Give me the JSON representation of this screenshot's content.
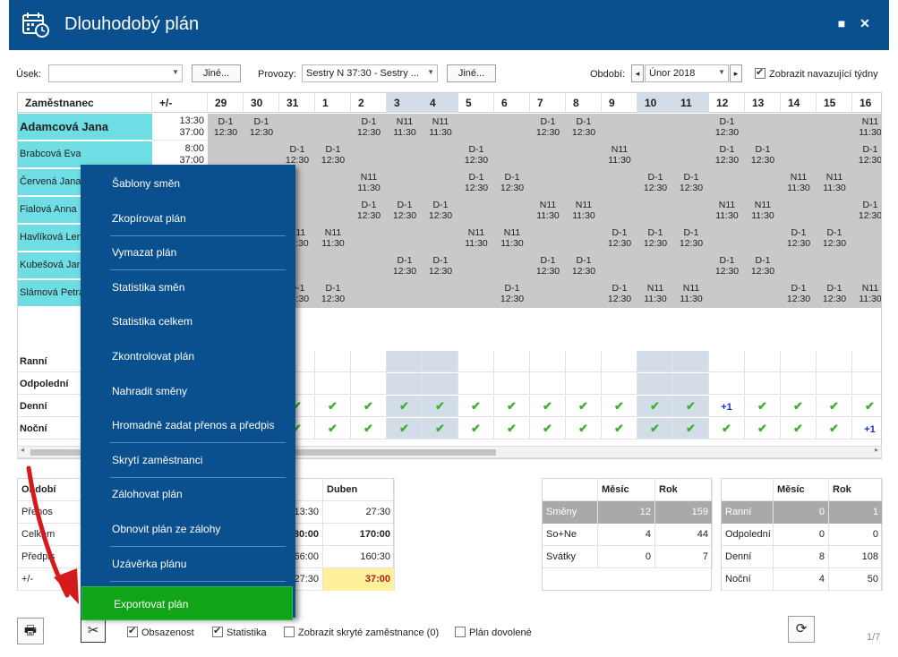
{
  "window": {
    "title": "Dlouhodobý plán",
    "minimize_symbol": "■",
    "close_symbol": "✕"
  },
  "toolbar": {
    "usek_label": "Úsek:",
    "usek_value": "",
    "jine1": "Jiné...",
    "provozy_label": "Provozy:",
    "provozy_value": "Sestry N 37:30 - Sestry ...",
    "jine2": "Jiné...",
    "obdobi_label": "Období:",
    "obdobi_value": "Únor 2018",
    "prev": "◂",
    "next": "▸",
    "show_weeks_label": "Zobrazit navazující týdny"
  },
  "grid": {
    "col_employee": "Zaměstnanec",
    "col_pm": "+/-",
    "days": [
      "29",
      "30",
      "31",
      "1",
      "2",
      "3",
      "4",
      "5",
      "6",
      "7",
      "8",
      "9",
      "10",
      "11",
      "12",
      "13",
      "14",
      "15",
      "16"
    ],
    "weekend": [
      5,
      6,
      12,
      13
    ],
    "employees": [
      {
        "name": "Adamcová Jana",
        "pm1": "13:30",
        "pm2": "37:00",
        "big": true,
        "shifts": [
          [
            "D-1",
            "12:30"
          ],
          [
            "D-1",
            "12:30"
          ],
          null,
          null,
          [
            "D-1",
            "12:30"
          ],
          [
            "N11",
            "11:30"
          ],
          [
            "N11",
            "11:30"
          ],
          null,
          null,
          [
            "D-1",
            "12:30"
          ],
          [
            "D-1",
            "12:30"
          ],
          null,
          null,
          null,
          [
            "D-1",
            "12:30"
          ],
          null,
          null,
          null,
          [
            "N11",
            "11:30"
          ]
        ]
      },
      {
        "name": "Brabcová Eva",
        "pm1": "8:00",
        "pm2": "37:00",
        "shifts": [
          null,
          null,
          [
            "D-1",
            "12:30"
          ],
          [
            "D-1",
            "12:30"
          ],
          null,
          null,
          null,
          [
            "D-1",
            "12:30"
          ],
          null,
          null,
          null,
          [
            "N11",
            "11:30"
          ],
          null,
          null,
          [
            "D-1",
            "12:30"
          ],
          [
            "D-1",
            "12:30"
          ],
          null,
          null,
          [
            "D-1",
            "12:30"
          ]
        ]
      },
      {
        "name": "Červená Jana",
        "shifts": [
          null,
          null,
          null,
          null,
          [
            "N11",
            "11:30"
          ],
          null,
          null,
          [
            "D-1",
            "12:30"
          ],
          [
            "D-1",
            "12:30"
          ],
          null,
          null,
          null,
          [
            "D-1",
            "12:30"
          ],
          [
            "D-1",
            "12:30"
          ],
          null,
          null,
          [
            "N11",
            "11:30"
          ],
          [
            "N11",
            "11:30"
          ],
          null
        ]
      },
      {
        "name": "Fialová Anna",
        "shifts": [
          null,
          null,
          null,
          null,
          [
            "D-1",
            "12:30"
          ],
          [
            "D-1",
            "12:30"
          ],
          [
            "D-1",
            "12:30"
          ],
          null,
          null,
          [
            "N11",
            "11:30"
          ],
          [
            "N11",
            "11:30"
          ],
          null,
          null,
          null,
          [
            "N11",
            "11:30"
          ],
          [
            "N11",
            "11:30"
          ],
          null,
          null,
          [
            "D-1",
            "12:30"
          ]
        ]
      },
      {
        "name": "Havlíková Lenka",
        "shifts": [
          null,
          null,
          [
            "N11",
            "11:30"
          ],
          [
            "N11",
            "11:30"
          ],
          null,
          null,
          null,
          [
            "N11",
            "11:30"
          ],
          [
            "N11",
            "11:30"
          ],
          null,
          null,
          [
            "D-1",
            "12:30"
          ],
          [
            "D-1",
            "12:30"
          ],
          [
            "D-1",
            "12:30"
          ],
          null,
          null,
          [
            "D-1",
            "12:30"
          ],
          [
            "D-1",
            "12:30"
          ],
          null
        ]
      },
      {
        "name": "Kubešová Jarosl.",
        "shifts": [
          null,
          null,
          null,
          null,
          null,
          [
            "D-1",
            "12:30"
          ],
          [
            "D-1",
            "12:30"
          ],
          null,
          null,
          [
            "D-1",
            "12:30"
          ],
          [
            "D-1",
            "12:30"
          ],
          null,
          null,
          null,
          [
            "D-1",
            "12:30"
          ],
          [
            "D-1",
            "12:30"
          ],
          null,
          null,
          null
        ]
      },
      {
        "name": "Slámová Petra",
        "shifts": [
          null,
          null,
          [
            "D-1",
            "12:30"
          ],
          [
            "D-1",
            "12:30"
          ],
          null,
          null,
          null,
          null,
          [
            "D-1",
            "12:30"
          ],
          null,
          null,
          [
            "D-1",
            "12:30"
          ],
          [
            "N11",
            "11:30"
          ],
          [
            "N11",
            "11:30"
          ],
          null,
          null,
          [
            "D-1",
            "12:30"
          ],
          [
            "D-1",
            "12:30"
          ],
          [
            "N11",
            "11:30"
          ]
        ]
      }
    ],
    "summary_rows": [
      "Ranní",
      "Odpolední",
      "Denní",
      "Noční"
    ],
    "denni_marks": [
      "✔",
      "✔",
      "✔",
      "✔",
      "✔",
      "✔",
      "✔",
      "✔",
      "✔",
      "✔",
      "✔",
      "✔",
      "✔",
      "✔",
      "+1",
      "✔",
      "✔",
      "✔",
      "✔"
    ],
    "nocni_marks": [
      "✔",
      "✔",
      "✔",
      "✔",
      "✔",
      "✔",
      "✔",
      "✔",
      "✔",
      "✔",
      "✔",
      "✔",
      "✔",
      "✔",
      "✔",
      "✔",
      "✔",
      "✔",
      "+1"
    ]
  },
  "bottom_left": {
    "headers": [
      "Období",
      "",
      "Duben"
    ],
    "rows": [
      [
        "Přenos",
        "13:30",
        "27:30"
      ],
      [
        "Celkem",
        "80:00",
        "170:00"
      ],
      [
        "Předpis",
        "66:00",
        "160:30"
      ],
      [
        "+/-",
        "27:30",
        "37:00"
      ]
    ]
  },
  "bottom_mid": {
    "headers": [
      "",
      "Měsíc",
      "Rok"
    ],
    "rows": [
      [
        "Směny",
        "12",
        "159"
      ],
      [
        "So+Ne",
        "4",
        "44"
      ],
      [
        "Svátky",
        "0",
        "7"
      ]
    ]
  },
  "bottom_right": {
    "headers": [
      "",
      "Měsíc",
      "Rok"
    ],
    "rows": [
      [
        "Ranní",
        "0",
        "1"
      ],
      [
        "Odpolední",
        "0",
        "0"
      ],
      [
        "Denní",
        "8",
        "108"
      ],
      [
        "Noční",
        "4",
        "50"
      ]
    ]
  },
  "menu": [
    "Šablony směn",
    "Zkopírovat plán",
    "Vymazat plán",
    "Statistika směn",
    "Statistika celkem",
    "Zkontrolovat plán",
    "Nahradit směny",
    "Hromadně zadat přenos a předpis",
    "Skrytí zaměstnanci",
    "Zálohovat plán",
    "Obnovit plán ze zálohy",
    "Uzávěrka plánu",
    "Exportovat plán"
  ],
  "footer": {
    "obsazenost": "Obsazenost",
    "statistika": "Statistika",
    "skryte": "Zobrazit skryté zaměstnance (0)",
    "dovolene": "Plán dovolené",
    "page": "1/7"
  },
  "colors": {
    "accent": "#0a4f8e",
    "employee_bg": "#6fdde4",
    "highlight": "#12a418",
    "arrow": "#d41a1a"
  }
}
